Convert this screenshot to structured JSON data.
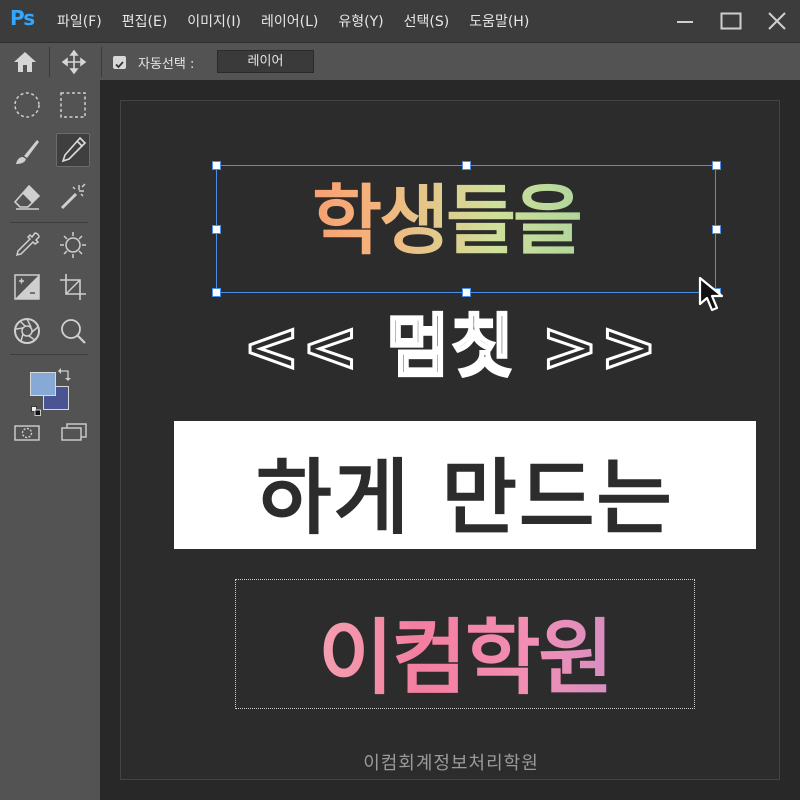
{
  "app": {
    "logo": "Ps",
    "menu": [
      "파일(F)",
      "편집(E)",
      "이미지(I)",
      "레이어(L)",
      "유형(Y)",
      "선택(S)",
      "도움말(H)"
    ]
  },
  "options": {
    "auto_select_label": "자동선택 :",
    "auto_select_checked": true,
    "auto_select_target": "레이어"
  },
  "tools": [
    "home-icon",
    "move-icon",
    "elliptical-marquee-icon",
    "rectangular-marquee-icon",
    "brush-icon",
    "pencil-icon",
    "eraser-icon",
    "magic-wand-icon",
    "eyedropper-icon",
    "brightness-icon",
    "gradient-map-icon",
    "crop-icon",
    "aperture-icon",
    "zoom-icon"
  ],
  "colors": {
    "foreground": "#86a9d6",
    "background": "#4b5493",
    "selection": "#4a8ee8"
  },
  "canvas": {
    "line1": "학생들을",
    "line2": "<< 멈칫 >>",
    "line3": "하게 만드는",
    "line4": "이컴학원",
    "footer": "이컴회계정보처리학원"
  }
}
